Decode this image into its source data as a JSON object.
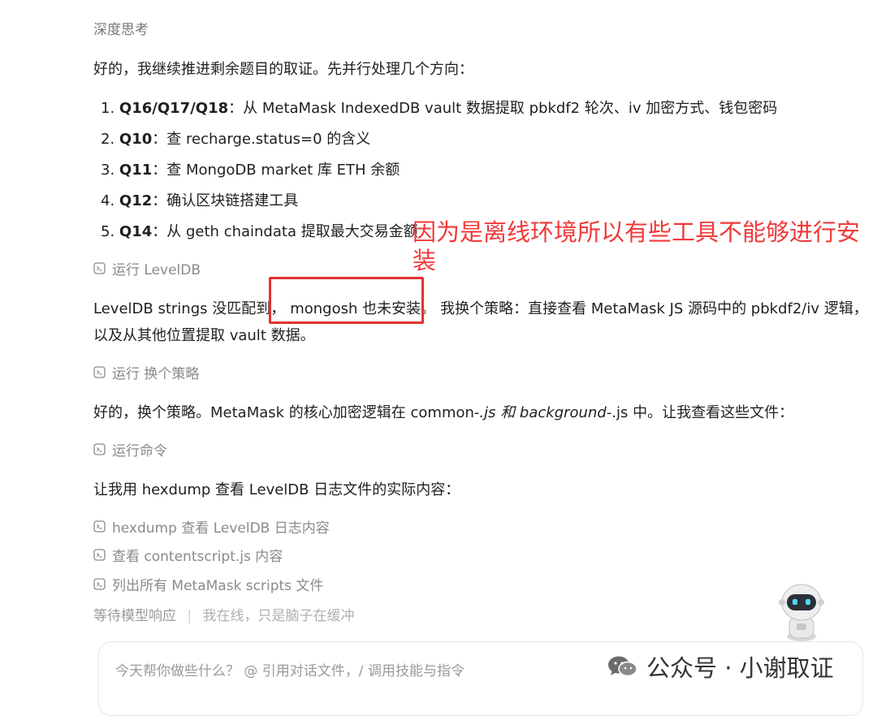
{
  "thinking": {
    "label": "深度思考"
  },
  "intro": "好的，我继续推进剩余题目的取证。先并行处理几个方向：",
  "tasks": [
    {
      "num": "1.",
      "q": "Q16/Q17/Q18",
      "sep": "：",
      "text": "从 MetaMask IndexedDB vault 数据提取 pbkdf2 轮次、iv 加密方式、钱包密码"
    },
    {
      "num": "2.",
      "q": "Q10",
      "sep": "：",
      "text": "查 recharge.status=0 的含义"
    },
    {
      "num": "3.",
      "q": "Q11",
      "sep": "：",
      "text": "查 MongoDB market 库 ETH 余额"
    },
    {
      "num": "4.",
      "q": "Q12",
      "sep": "：",
      "text": "确认区块链搭建工具"
    },
    {
      "num": "5.",
      "q": "Q14",
      "sep": "：",
      "text": "从 geth chaindata 提取最大交易金额"
    }
  ],
  "annotation": {
    "line1": "因为是离线环境所以有些工具不能够进行安",
    "line2": "装"
  },
  "tool_run_1": "运行 LevelDB",
  "para1": {
    "a": "LevelDB strings 没匹配到，",
    "b": "mongosh 也未安装。",
    "c": "我换个策略：直接查看 MetaMask JS 源码中的 pbkdf2/iv 逻辑，",
    "line2": "以及从其他位置提取 vault 数据。"
  },
  "tool_run_2": "运行 换个策略",
  "para2": {
    "a": "好的，换个策略。MetaMask 的核心加密逻辑在 common-",
    "b": ".js 和 background-",
    "c": ".js 中。让我查看这些文件："
  },
  "tool_run_3": "运行命令",
  "para3": "让我用 hexdump 查看 LevelDB 日志文件的实际内容：",
  "tool_items": [
    "hexdump 查看 LevelDB 日志内容",
    "查看 contentscript.js 内容",
    "列出所有 MetaMask scripts 文件"
  ],
  "status": {
    "waiting": "等待模型响应",
    "sep": "|",
    "online": "我在线，只是脑子在缓冲"
  },
  "input": {
    "placeholder": "今天帮你做些什么？ @ 引用对话文件，/ 调用技能与指令"
  },
  "watermark": {
    "text": "公众号 · 小谢取证"
  },
  "colors": {
    "annotation": "#f03a3a",
    "box": "#e33232",
    "muted": "#8a8a8a"
  },
  "icons": [
    "terminal-icon",
    "wechat-icon",
    "robot-mascot"
  ]
}
